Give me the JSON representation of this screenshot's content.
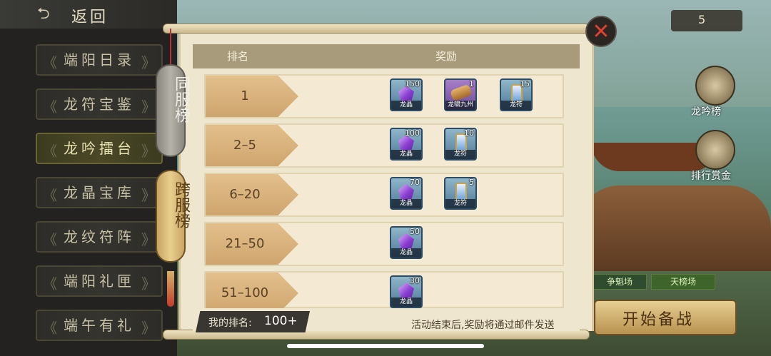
{
  "back": {
    "label": "返回"
  },
  "sidebar": {
    "items": [
      {
        "label": "端阳日录"
      },
      {
        "label": "龙符宝鉴"
      },
      {
        "label": "龙吟擂台"
      },
      {
        "label": "龙晶宝库"
      },
      {
        "label": "龙纹符阵"
      },
      {
        "label": "端阳礼匣"
      },
      {
        "label": "端午有礼"
      }
    ]
  },
  "tabs": {
    "same_server": "同服榜",
    "cross_server": "跨服榜"
  },
  "table": {
    "header_rank": "排名",
    "header_reward": "奖励",
    "rows": [
      {
        "rank": "1",
        "rewards": [
          {
            "icon": "crystal-icon",
            "name": "龙晶",
            "count": "150"
          },
          {
            "icon": "scroll-icon",
            "name": "龙啸九州",
            "count": "1"
          },
          {
            "icon": "tally-icon",
            "name": "龙符",
            "count": "15"
          }
        ]
      },
      {
        "rank": "2–5",
        "rewards": [
          {
            "icon": "crystal-icon",
            "name": "龙晶",
            "count": "100"
          },
          {
            "icon": "tally-icon",
            "name": "龙符",
            "count": "10"
          }
        ]
      },
      {
        "rank": "6–20",
        "rewards": [
          {
            "icon": "crystal-icon",
            "name": "龙晶",
            "count": "70"
          },
          {
            "icon": "tally-icon",
            "name": "龙符",
            "count": "5"
          }
        ]
      },
      {
        "rank": "21–50",
        "rewards": [
          {
            "icon": "crystal-icon",
            "name": "龙晶",
            "count": "50"
          }
        ]
      },
      {
        "rank": "51–100",
        "rewards": [
          {
            "icon": "crystal-icon",
            "name": "龙晶",
            "count": "30"
          }
        ]
      }
    ]
  },
  "footer": {
    "my_rank_label": "我的排名:",
    "my_rank_value": "100+",
    "note": "活动结束后,奖励将通过邮件发送"
  },
  "right": {
    "counter": "5",
    "longyin_label": "龙吟榜",
    "reward_label": "排行赏金",
    "tab_a": "争魁场",
    "tab_b": "天榜场",
    "start_label": "开始备战"
  }
}
